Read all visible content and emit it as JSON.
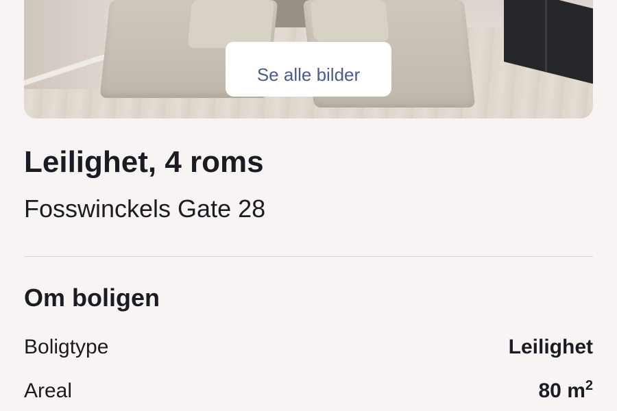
{
  "hero": {
    "see_all_label": "Se alle bilder"
  },
  "listing": {
    "title": "Leilighet, 4 roms",
    "address": "Fosswinckels Gate 28"
  },
  "about": {
    "heading": "Om boligen",
    "rows": [
      {
        "label": "Boligtype",
        "value": "Leilighet"
      },
      {
        "label": "Areal",
        "value": "80 m",
        "unit_superscript": "2"
      }
    ]
  },
  "colors": {
    "background": "#f8f4f3",
    "text": "#1b1b24",
    "button_text": "#4d5a8c",
    "divider": "#d9d3dc"
  }
}
